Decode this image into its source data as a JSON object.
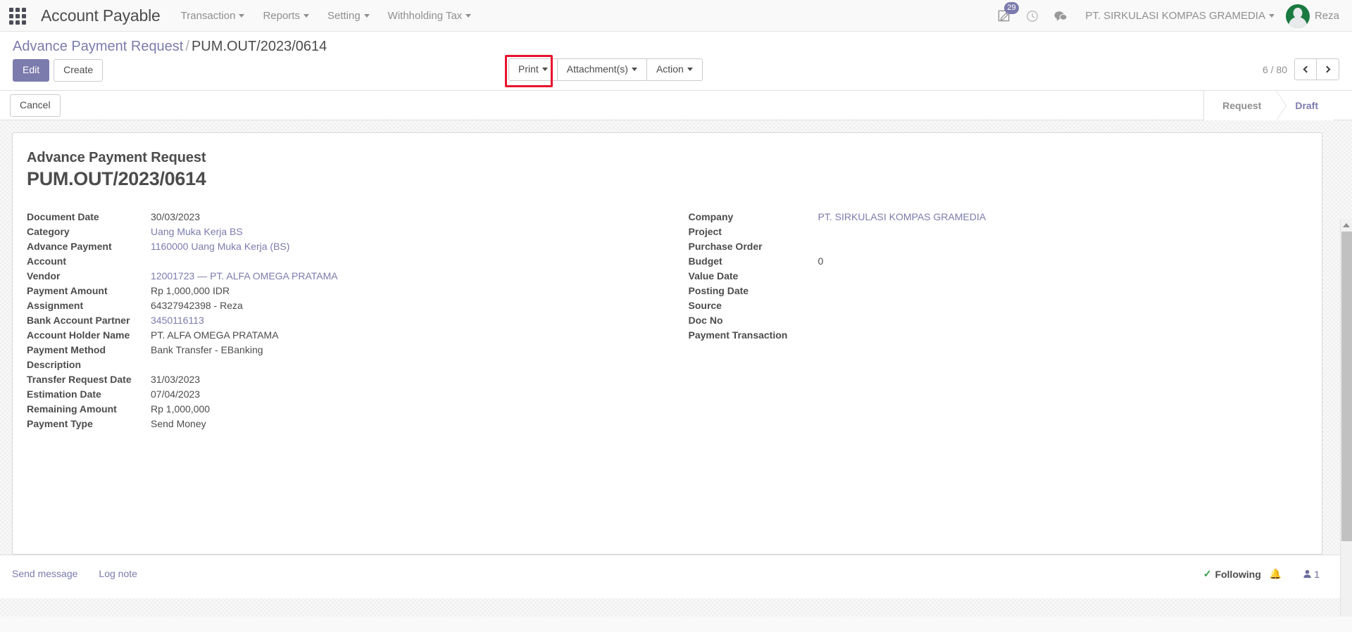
{
  "navbar": {
    "apps_icon": "apps-grid-icon",
    "brand": "Account Payable",
    "menus": [
      {
        "label": "Transaction"
      },
      {
        "label": "Reports"
      },
      {
        "label": "Setting"
      },
      {
        "label": "Withholding Tax"
      }
    ],
    "activity_badge": "29",
    "icons": [
      {
        "name": "activity-icon"
      },
      {
        "name": "clock-icon"
      },
      {
        "name": "messages-icon"
      }
    ],
    "company": "PT. SIRKULASI KOMPAS GRAMEDIA",
    "user": "Reza"
  },
  "control_panel": {
    "breadcrumb_parent": "Advance Payment Request",
    "breadcrumb_sep": "/",
    "breadcrumb_current": "PUM.OUT/2023/0614",
    "edit_label": "Edit",
    "create_label": "Create",
    "print_label": "Print",
    "attachments_label": "Attachment(s)",
    "action_label": "Action",
    "pager": "6 / 80",
    "highlight_color": "#e8112d"
  },
  "statusbar": {
    "cancel_label": "Cancel",
    "stages": [
      {
        "label": "Request",
        "active": false
      },
      {
        "label": "Draft",
        "active": true
      }
    ]
  },
  "sheet": {
    "title_sub": "Advance Payment Request",
    "title_main": "PUM.OUT/2023/0614",
    "left_fields": [
      {
        "label": "Document Date",
        "value": "30/03/2023",
        "link": false
      },
      {
        "label": "Category",
        "value": "Uang Muka Kerja BS",
        "link": true
      },
      {
        "label": "Advance Payment Account",
        "value": "1160000 Uang Muka Kerja (BS)",
        "link": true
      },
      {
        "label": "Vendor",
        "value": "12001723 — PT. ALFA OMEGA PRATAMA",
        "link": true
      },
      {
        "label": "Payment Amount",
        "value": "Rp 1,000,000  IDR",
        "link": false
      },
      {
        "label": "Assignment",
        "value": "64327942398 - Reza",
        "link": false
      },
      {
        "label": "Bank Account Partner",
        "value": "3450116113",
        "link": true
      },
      {
        "label": "Account Holder Name",
        "value": "PT. ALFA OMEGA PRATAMA",
        "link": false
      },
      {
        "label": "Payment Method",
        "value": "Bank Transfer - EBanking",
        "link": false
      },
      {
        "label": "Description",
        "value": "",
        "link": false
      },
      {
        "label": "Transfer Request Date",
        "value": "31/03/2023",
        "link": false
      },
      {
        "label": "Estimation Date",
        "value": "07/04/2023",
        "link": false
      },
      {
        "label": "Remaining Amount",
        "value": "Rp 1,000,000",
        "link": false
      },
      {
        "label": "Payment Type",
        "value": "Send Money",
        "link": false
      }
    ],
    "right_fields": [
      {
        "label": "Company",
        "value": "PT. SIRKULASI KOMPAS GRAMEDIA",
        "link": true
      },
      {
        "label": "Project",
        "value": "",
        "link": false
      },
      {
        "label": "Purchase Order",
        "value": "",
        "link": false
      },
      {
        "label": "Budget",
        "value": "0",
        "link": false
      },
      {
        "label": "Value Date",
        "value": "",
        "link": false
      },
      {
        "label": "Posting Date",
        "value": "",
        "link": false
      },
      {
        "label": "Source",
        "value": "",
        "link": false
      },
      {
        "label": "Doc No",
        "value": "",
        "link": false
      },
      {
        "label": "Payment Transaction",
        "value": "",
        "link": false
      }
    ]
  },
  "chatter": {
    "send_message": "Send message",
    "log_note": "Log note",
    "following": "Following",
    "followers_count": "1"
  }
}
